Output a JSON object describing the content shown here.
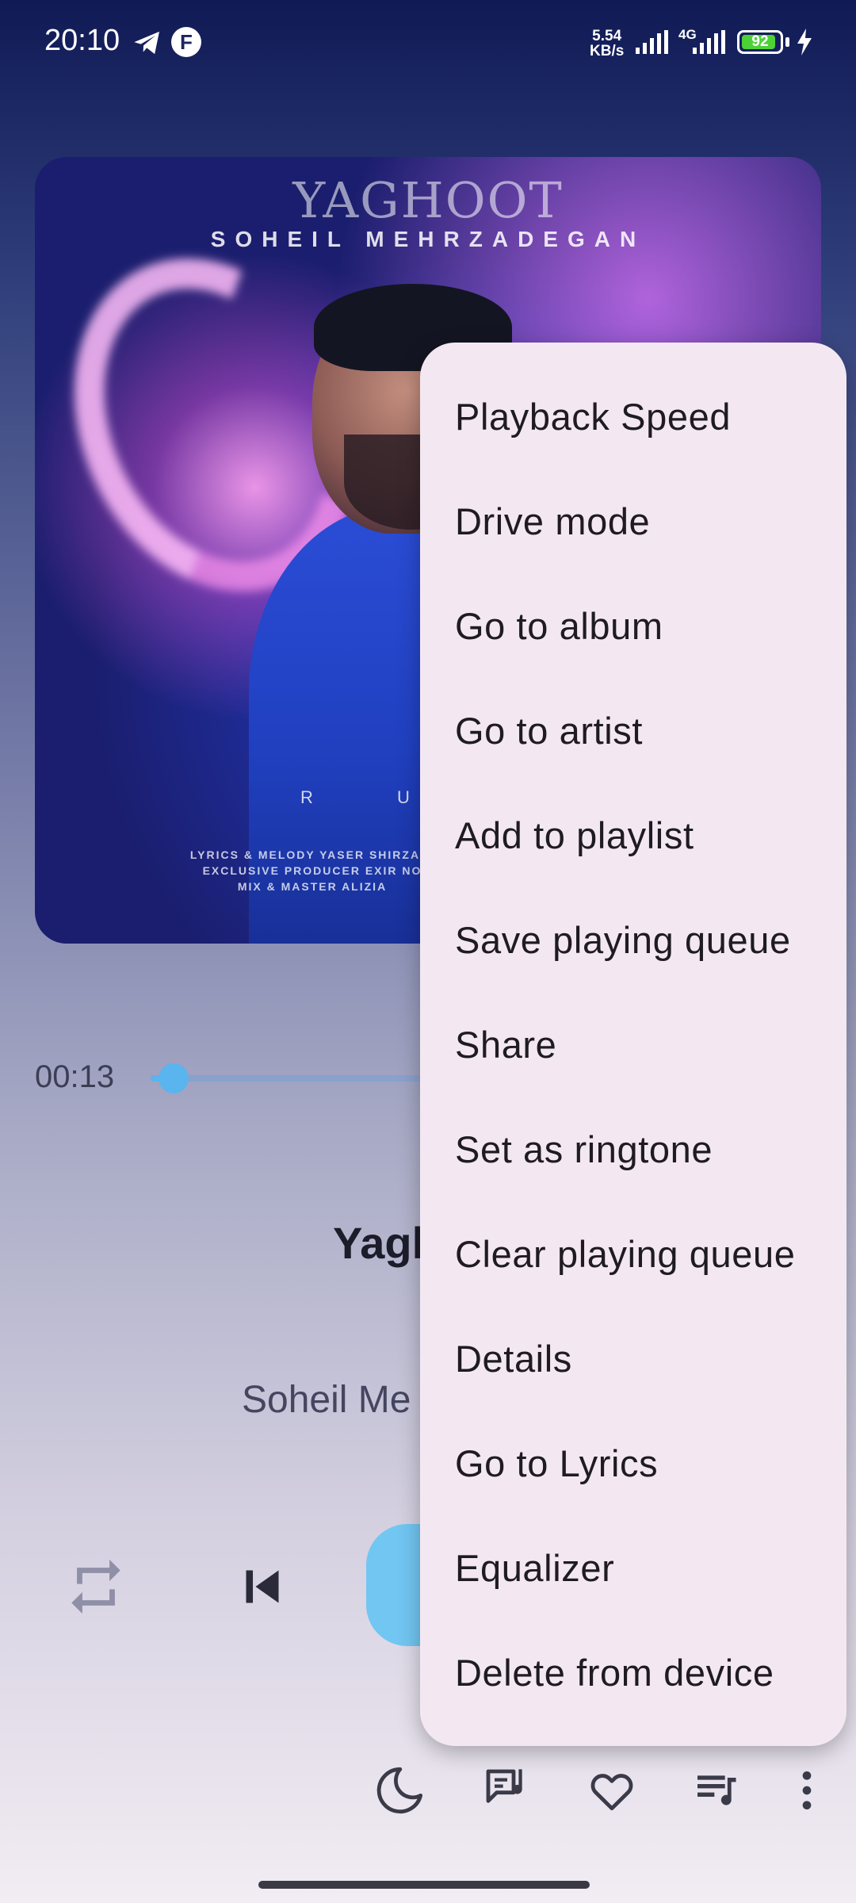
{
  "status_bar": {
    "time": "20:10",
    "net_speed_value": "5.54",
    "net_speed_unit": "KB/s",
    "network_type": "4G",
    "battery": "92",
    "battery_level": 0.92
  },
  "album_art": {
    "title": "YAGHOOT",
    "artist": "SOHEIL MEHRZADEGAN",
    "letters": "R U",
    "credits": [
      "LYRICS & MELODY YASER SHIRZADI",
      "EXCLUSIVE PRODUCER EXIR NO",
      "MIX & MASTER ALIZIA"
    ]
  },
  "player": {
    "elapsed": "00:13",
    "progress": 0.035,
    "song_title": "Yagh",
    "artist": "Soheil Me"
  },
  "controls": {
    "repeat_icon": "repeat-icon",
    "previous_icon": "skip-previous-icon",
    "play_pause_icon": "pause-icon"
  },
  "bottom_bar": {
    "icons": [
      "moon-icon",
      "lyrics-icon",
      "heart-icon",
      "queue-music-icon",
      "more-vert-icon"
    ]
  },
  "menu": {
    "items": [
      "Playback Speed",
      "Drive mode",
      "Go to album",
      "Go to artist",
      "Add to playlist",
      "Save playing queue",
      "Share",
      "Set as ringtone",
      "Clear playing queue",
      "Details",
      "Go to Lyrics",
      "Equalizer",
      "Delete from device"
    ]
  },
  "colors": {
    "accent": "#5ab4ee",
    "menu_bg": "#f3e8f1",
    "battery_green": "#4cd137"
  }
}
